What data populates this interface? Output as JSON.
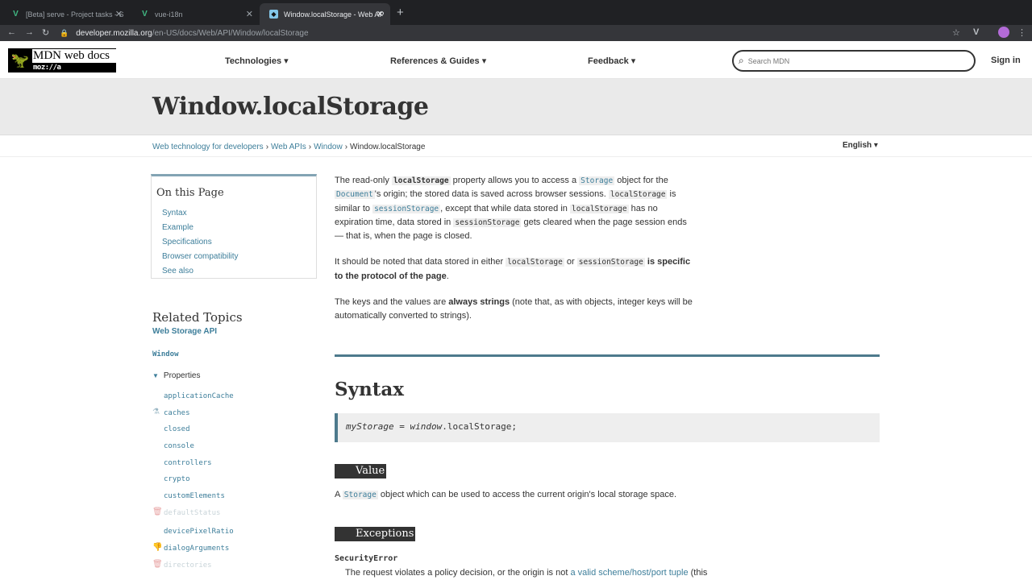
{
  "browser": {
    "tabs": [
      {
        "title": "[Beta] serve - Project tasks - S"
      },
      {
        "title": "vue-i18n"
      },
      {
        "title": "Window.localStorage - Web AP"
      }
    ],
    "url_host": "developer.mozilla.org",
    "url_path": "/en-US/docs/Web/API/Window/localStorage"
  },
  "header": {
    "logo_text": "MDN web docs",
    "logo_sub": "moz://a",
    "nav": [
      "Technologies ▾",
      "References & Guides ▾",
      "Feedback ▾"
    ],
    "search_placeholder": "Search MDN",
    "signin": "Sign in"
  },
  "page": {
    "title": "Window.localStorage",
    "breadcrumbs": [
      "Web technology for developers",
      "Web APIs",
      "Window",
      "Window.localStorage"
    ],
    "language": "English ▾"
  },
  "toc": {
    "heading": "On this Page",
    "items": [
      "Syntax",
      "Example",
      "Specifications",
      "Browser compatibility",
      "See also"
    ]
  },
  "related": {
    "heading": "Related Topics",
    "api": "Web Storage API",
    "interface": "Window",
    "group": "Properties",
    "properties": [
      "applicationCache",
      "caches",
      "closed",
      "console",
      "controllers",
      "crypto",
      "customElements",
      "defaultStatus",
      "devicePixelRatio",
      "dialogArguments",
      "directories"
    ]
  },
  "article": {
    "p1": {
      "a": "The read-only ",
      "b": "localStorage",
      "c": " property allows you to access a ",
      "d": "Storage",
      "e": " object for the ",
      "f": "Document",
      "g": "'s origin; the stored data is saved across browser sessions. ",
      "h": "localStorage",
      "i": " is similar to ",
      "j": "sessionStorage",
      "k": ", except that while data stored in ",
      "l": "localStorage",
      "m": " has no expiration time, data stored in ",
      "n": "sessionStorage",
      "o": " gets cleared when the page session ends — that is, when the page is closed."
    },
    "p2": {
      "a": "It should be noted that data stored in either ",
      "b": "localStorage",
      "c": " or ",
      "d": "sessionStorage",
      "e": " is specific to the protocol of the page",
      "f": "."
    },
    "p3": {
      "a": "The keys and the values are ",
      "b": "always strings",
      "c": " (note that, as with objects, integer keys will be automatically converted to strings)."
    },
    "syntax_heading": "Syntax",
    "code": {
      "var": "myStorage",
      "eq": " = ",
      "obj": "window",
      "rest": ".localStorage;"
    },
    "value_heading": "Value",
    "value_text": {
      "a": "A ",
      "b": "Storage",
      "c": " object which can be used to access the current origin's local storage space."
    },
    "exceptions_heading": "Exceptions",
    "error_name": "SecurityError",
    "error_text": {
      "a": "The request violates a policy decision, or the origin is not ",
      "b": "a valid scheme/host/port tuple",
      "c": " (this"
    }
  }
}
